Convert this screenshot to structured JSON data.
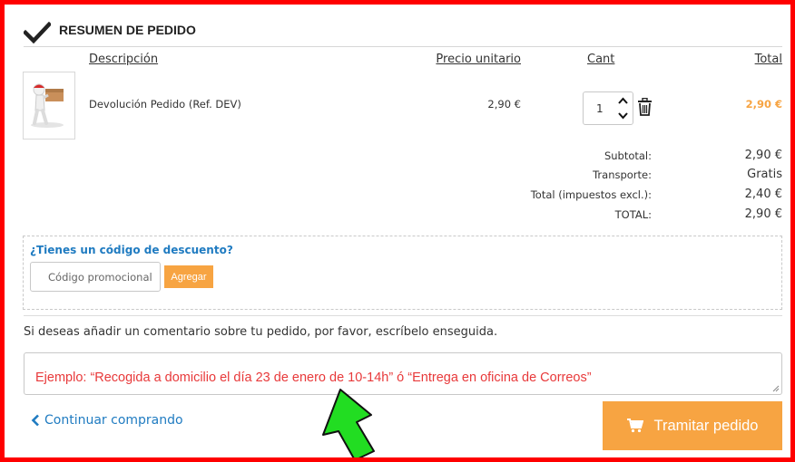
{
  "header": {
    "title": "RESUMEN DE PEDIDO",
    "icon": "checkmark-icon"
  },
  "columns": {
    "description": "Descripción",
    "unit_price": "Precio unitario",
    "quantity": "Cant",
    "total": "Total"
  },
  "item": {
    "name": "Devolución Pedido (Ref. DEV)",
    "unit_price": "2,90 €",
    "quantity": "1",
    "total": "2,90 €",
    "image_icon": "package-delivery-figure-icon"
  },
  "summary": [
    {
      "label": "Subtotal:",
      "value": "2,90 €"
    },
    {
      "label": "Transporte:",
      "value": "Gratis"
    },
    {
      "label": "Total (impuestos excl.):",
      "value": "2,40 €"
    },
    {
      "label": "TOTAL:",
      "value": "2,90 €"
    }
  ],
  "promo": {
    "question": "¿Tienes un código de descuento?",
    "placeholder": "Código promocional",
    "apply_label": "Agregar"
  },
  "comment": {
    "label": "Si deseas añadir un comentario sobre tu pedido, por favor, escríbelo enseguida.",
    "example": "Ejemplo: “Recogida a domicilio el día 23 de enero de 10-14h” ó “Entrega en oficina de Correos”"
  },
  "actions": {
    "continue_label": "Continuar comprando",
    "checkout_label": "Tramitar pedido"
  },
  "colors": {
    "accent": "#f7a442",
    "link": "#1f7bc1",
    "example_text": "#e8393a",
    "annotation_arrow": "#22dd22",
    "frame": "#ff0000"
  }
}
